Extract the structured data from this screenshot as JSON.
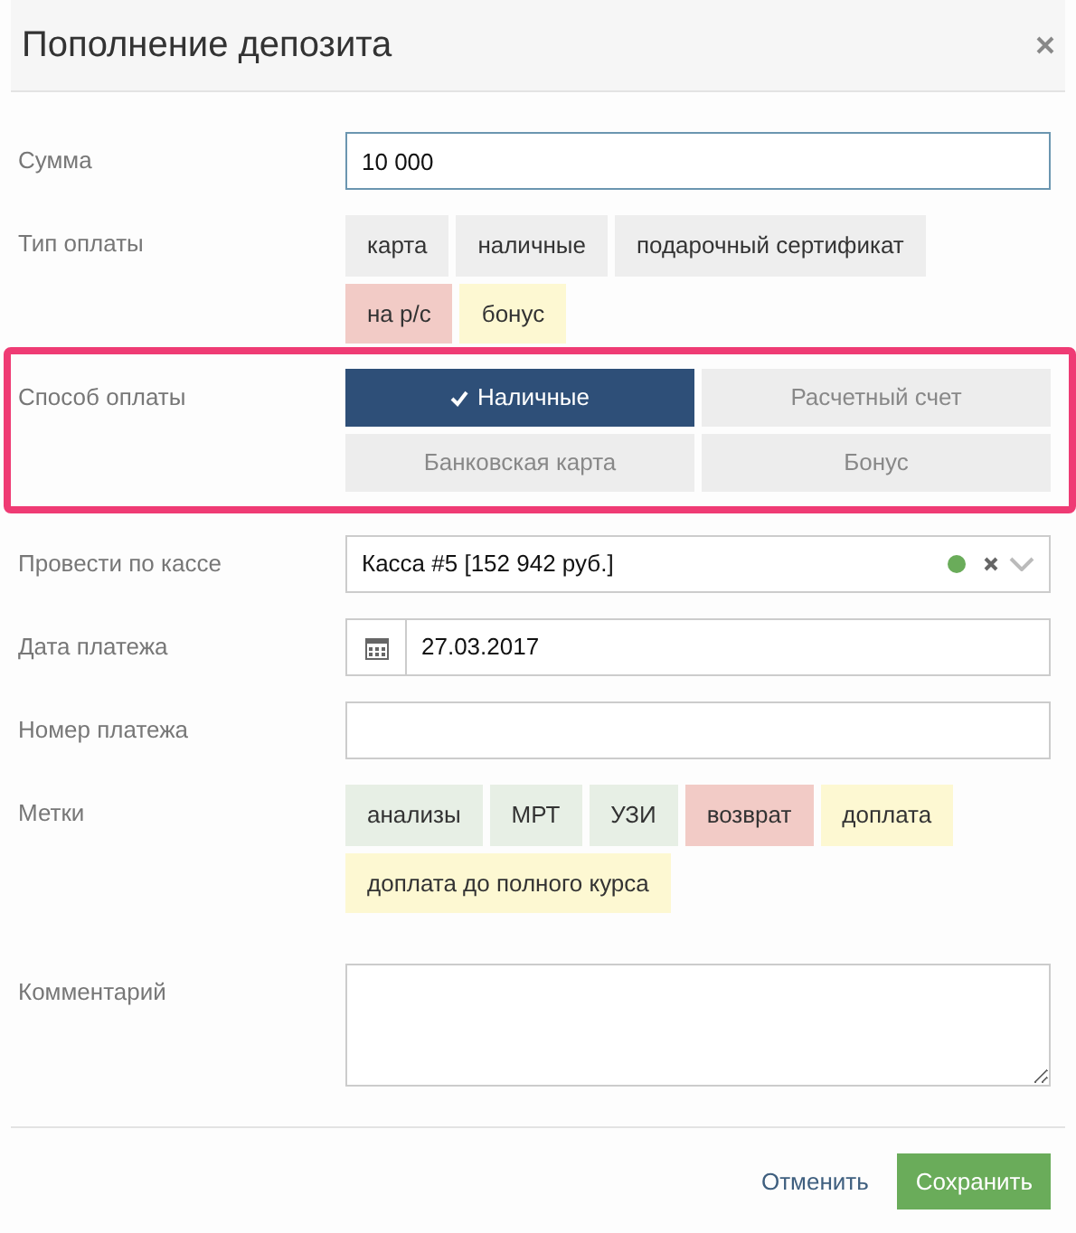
{
  "dialog": {
    "title": "Пополнение депозита"
  },
  "amount": {
    "label": "Сумма",
    "value": "10 000"
  },
  "payment_type": {
    "label": "Тип оплаты",
    "tags": [
      {
        "label": "карта",
        "color": "#eeeeee"
      },
      {
        "label": "наличные",
        "color": "#eeeeee"
      },
      {
        "label": "подарочный сертификат",
        "color": "#eeeeee"
      },
      {
        "label": "на р/с",
        "color": "#f2cbc6"
      },
      {
        "label": "бонус",
        "color": "#fdf8d2"
      }
    ]
  },
  "payment_method": {
    "label": "Способ оплаты",
    "highlighted": true,
    "options": [
      {
        "label": "Наличные",
        "selected": true
      },
      {
        "label": "Расчетный счет",
        "selected": false
      },
      {
        "label": "Банковская карта",
        "selected": false
      },
      {
        "label": "Бонус",
        "selected": false
      }
    ]
  },
  "cashbox": {
    "label": "Провести по кассе",
    "value": "Касса #5 [152 942 руб.]"
  },
  "date": {
    "label": "Дата платежа",
    "value": "27.03.2017"
  },
  "payment_number": {
    "label": "Номер платежа"
  },
  "tags": {
    "label": "Метки",
    "items": [
      {
        "label": "анализы",
        "color": "#e7efe5"
      },
      {
        "label": "МРТ",
        "color": "#e7efe5"
      },
      {
        "label": "УЗИ",
        "color": "#e7efe5"
      },
      {
        "label": "возврат",
        "color": "#f2cbc6"
      },
      {
        "label": "доплата",
        "color": "#fdf8d2"
      },
      {
        "label": "доплата до полного курса",
        "color": "#fdf8d2"
      }
    ]
  },
  "comment": {
    "label": "Комментарий"
  },
  "buttons": {
    "cancel": "Отменить",
    "save": "Сохранить"
  }
}
